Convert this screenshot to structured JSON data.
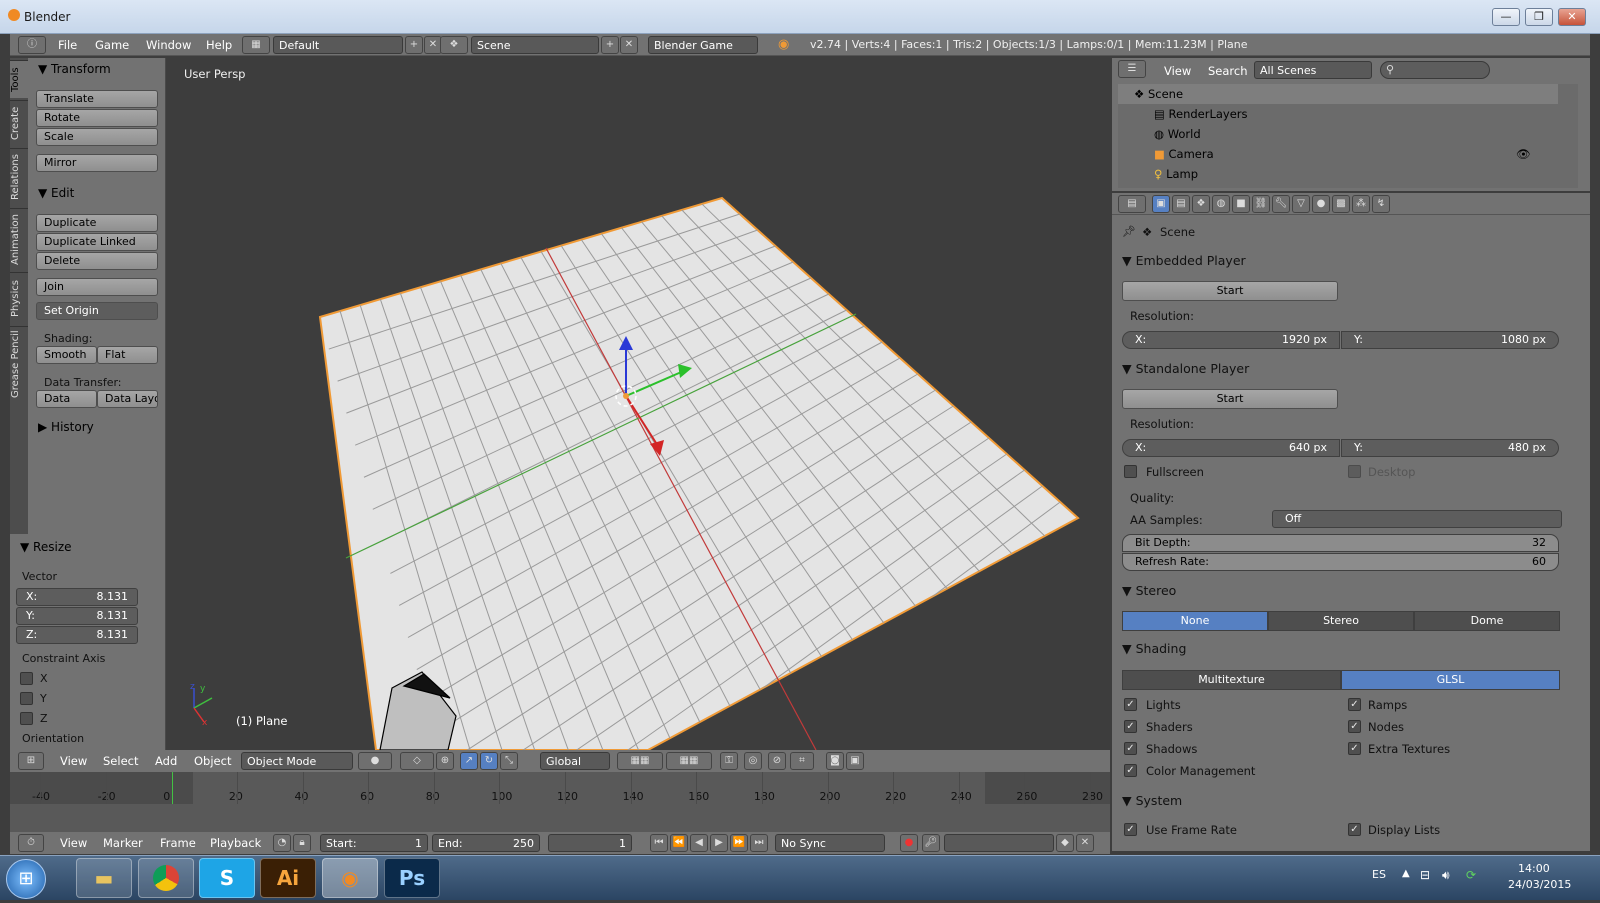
{
  "window": {
    "title": "Blender",
    "minimize": "—",
    "maximize": "❐",
    "close": "✕"
  },
  "infobar": {
    "menus": [
      "File",
      "Game",
      "Window",
      "Help"
    ],
    "screen_layout": "Default",
    "scene": "Scene",
    "engine": "Blender Game",
    "stats": "v2.74 | Verts:4 | Faces:1 | Tris:2 | Objects:1/3 | Lamps:0/1 | Mem:11.23M | Plane"
  },
  "left_tabs": [
    "Tools",
    "Create",
    "Relations",
    "Animation",
    "Physics",
    "Grease Pencil"
  ],
  "toolshelf": {
    "transform_header": "Transform",
    "transform_buttons": [
      "Translate",
      "Rotate",
      "Scale"
    ],
    "mirror": "Mirror",
    "edit_header": "Edit",
    "edit_buttons": [
      "Duplicate",
      "Duplicate Linked",
      "Delete"
    ],
    "join": "Join",
    "set_origin": "Set Origin",
    "shading_label": "Shading:",
    "smooth": "Smooth",
    "flat": "Flat",
    "data_transfer_label": "Data Transfer:",
    "data": "Data",
    "data_layo": "Data Layo",
    "history_header": "History"
  },
  "redo_panel": {
    "header": "Resize",
    "vector_label": "Vector",
    "x": "X:",
    "x_val": "8.131",
    "y": "Y:",
    "y_val": "8.131",
    "z": "Z:",
    "z_val": "8.131",
    "constraint_label": "Constraint Axis",
    "axes": [
      "X",
      "Y",
      "Z"
    ],
    "orientation_label": "Orientation"
  },
  "viewport": {
    "label": "User Persp",
    "object_label": "(1) Plane",
    "axis_x": "x",
    "axis_y": "y",
    "axis_z": "z"
  },
  "viewport_header": {
    "menus": [
      "View",
      "Select",
      "Add",
      "Object"
    ],
    "mode": "Object Mode",
    "orientation": "Global"
  },
  "timeline": {
    "ticks": [
      "-40",
      "-20",
      "0",
      "20",
      "40",
      "60",
      "80",
      "100",
      "120",
      "140",
      "160",
      "180",
      "200",
      "220",
      "240",
      "260",
      "280"
    ],
    "current_frame_value": 0,
    "menus": [
      "View",
      "Marker",
      "Frame",
      "Playback"
    ],
    "start_label": "Start:",
    "start_val": "1",
    "end_label": "End:",
    "end_val": "250",
    "current_val": "1",
    "sync": "No Sync"
  },
  "outliner": {
    "menus": [
      "View",
      "Search"
    ],
    "filter": "All Scenes",
    "search_placeholder": "",
    "items": [
      "Scene",
      "RenderLayers",
      "World",
      "Camera",
      "Lamp"
    ]
  },
  "properties": {
    "context": "Scene",
    "embedded_header": "Embedded Player",
    "embedded_start": "Start",
    "resolution_label": "Resolution:",
    "emb_x_label": "X:",
    "emb_x": "1920 px",
    "emb_y_label": "Y:",
    "emb_y": "1080 px",
    "standalone_header": "Standalone Player",
    "standalone_start": "Start",
    "standalone_resolution_label": "Resolution:",
    "st_x_label": "X:",
    "st_x": "640 px",
    "st_y_label": "Y:",
    "st_y": "480 px",
    "fullscreen": "Fullscreen",
    "desktop": "Desktop",
    "quality_label": "Quality:",
    "aa_label": "AA Samples:",
    "aa_value": "Off",
    "bit_depth_label": "Bit Depth:",
    "bit_depth": "32",
    "refresh_label": "Refresh Rate:",
    "refresh": "60",
    "stereo_header": "Stereo",
    "stereo_options": [
      "None",
      "Stereo",
      "Dome"
    ],
    "shading_header": "Shading",
    "shading_options": [
      "Multitexture",
      "GLSL"
    ],
    "shading_checks": [
      "Lights",
      "Ramps",
      "Shaders",
      "Nodes",
      "Shadows",
      "Extra Textures",
      "Color Management"
    ],
    "system_header": "System",
    "system_checks": [
      "Use Frame Rate",
      "Display Lists"
    ]
  },
  "taskbar": {
    "apps": [
      "Windows Explorer",
      "Chrome",
      "Skype",
      "Illustrator",
      "Blender",
      "Photoshop"
    ],
    "app_glyphs": {
      "skype": "S",
      "illustrator": "Ai",
      "photoshop": "Ps"
    },
    "lang": "ES",
    "time": "14:00",
    "date": "24/03/2015"
  },
  "colors": {
    "selected_blue": "#5680c2",
    "active_orange": "#f09a36",
    "grid": "#d6d6d6"
  }
}
